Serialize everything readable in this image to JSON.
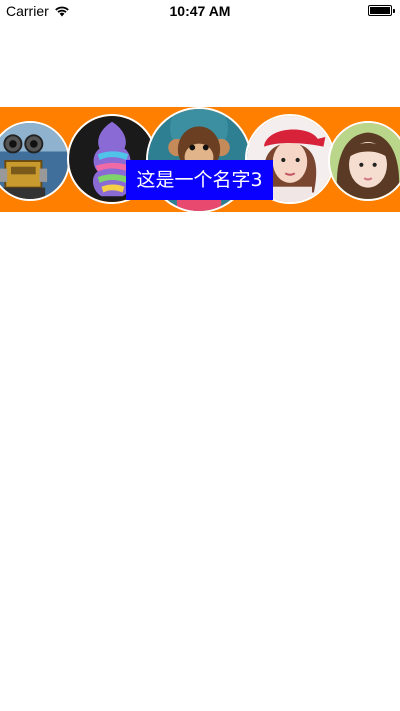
{
  "status_bar": {
    "carrier": "Carrier",
    "time": "10:47 AM",
    "battery_level": 1.0
  },
  "carousel": {
    "background": "#ff7f00",
    "selected_index": 2,
    "selected_name": "这是一个名字3",
    "label_color": "#0a00ff",
    "items": [
      {
        "subject": "robot"
      },
      {
        "subject": "ice-cream"
      },
      {
        "subject": "monkey"
      },
      {
        "subject": "girl-with-red-cap"
      },
      {
        "subject": "girl-portrait"
      }
    ]
  }
}
